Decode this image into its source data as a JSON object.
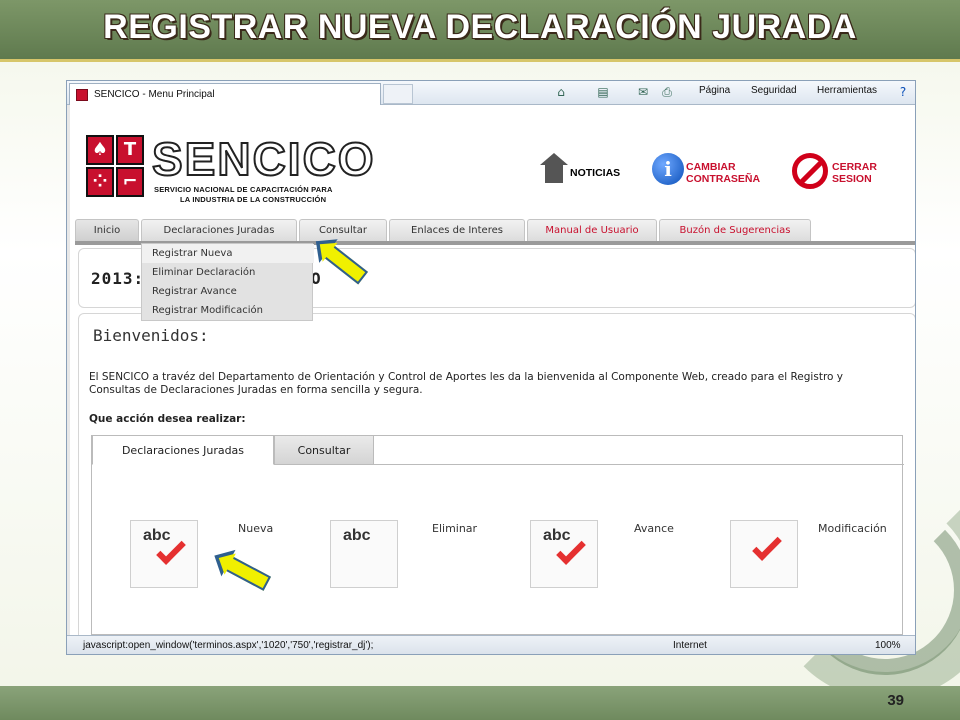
{
  "slide": {
    "title": "REGISTRAR NUEVA DECLARACIÓN JURADA",
    "page_number": "39"
  },
  "browser": {
    "tab_title": "SENCICO - Menu Principal",
    "toolbar": {
      "page": "Página",
      "security": "Seguridad",
      "tools": "Herramientas"
    },
    "status": {
      "url": "javascript:open_window('terminos.aspx','1020','750','registrar_dj');",
      "zone": "Internet",
      "zoom": "100%"
    }
  },
  "header": {
    "logo_word": "SENCICO",
    "logo_sub1": "SERVICIO NACIONAL DE CAPACITACIÓN PARA",
    "logo_sub2": "LA INDUSTRIA DE LA CONSTRUCCIÓN",
    "news": "NOTICIAS",
    "change_pw_1": "CAMBIAR",
    "change_pw_2": "CONTRASEÑA",
    "logout_1": "CERRAR",
    "logout_2": "SESION"
  },
  "nav": {
    "items": [
      {
        "label": "Inicio"
      },
      {
        "label": "Declaraciones Juradas"
      },
      {
        "label": "Consultar"
      },
      {
        "label": "Enlaces de Interes"
      },
      {
        "label": "Manual de Usuario"
      },
      {
        "label": "Buzón de Sugerencias"
      }
    ],
    "dropdown": [
      {
        "label": "Registrar Nueva"
      },
      {
        "label": "Eliminar Declaración"
      },
      {
        "label": "Registrar Avance"
      },
      {
        "label": "Registrar Modificación"
      }
    ]
  },
  "year_bar": {
    "year": "2013:",
    "suffix": "O"
  },
  "welcome": {
    "title": "Bienvenidos:",
    "line1": "El SENCICO a travéz del Departamento de Orientación y Control de Aportes les da la bienvenida al Componente Web, creado para el Registro y",
    "line2": "Consultas de Declaraciones Juradas en forma sencilla y segura.",
    "question": "Que acción desea realizar:",
    "tabs": [
      {
        "label": "Declaraciones Juradas"
      },
      {
        "label": "Consultar"
      }
    ],
    "actions": [
      {
        "label": "Nueva",
        "icon_text": "abc"
      },
      {
        "label": "Eliminar",
        "icon_text": "abc"
      },
      {
        "label": "Avance",
        "icon_text": "abc"
      },
      {
        "label": "Modificación",
        "icon_text": ""
      }
    ]
  },
  "colors": {
    "accent_red": "#c8102e",
    "arrow_yellow": "#f0f000",
    "slide_green": "#6f8a5e"
  }
}
